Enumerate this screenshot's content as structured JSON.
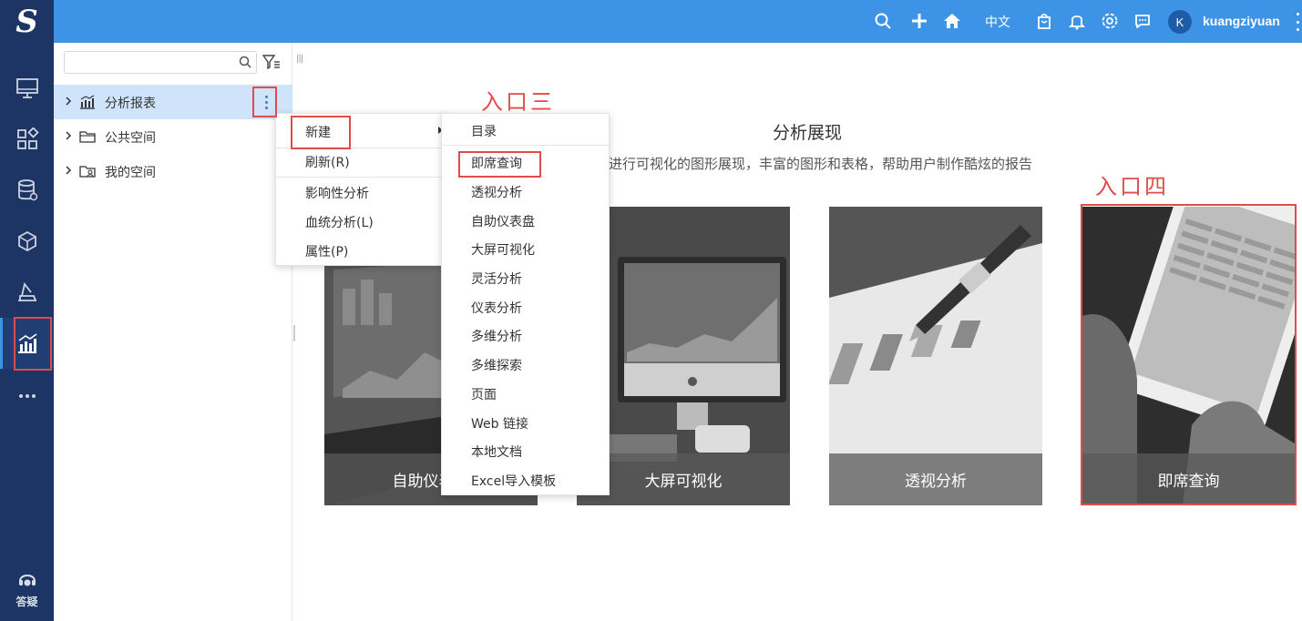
{
  "topbar": {
    "logo": "S",
    "language": "中文",
    "avatar_initial": "K",
    "username": "kuangziyuan",
    "icons": [
      "search-icon",
      "plus-icon",
      "home-icon",
      "bag-icon",
      "bell-icon",
      "settings-eye-icon",
      "chat-icon",
      "more-vertical-icon"
    ]
  },
  "leftnav": {
    "items": [
      "monitor-icon",
      "grid-icon",
      "database-icon",
      "cube-icon",
      "analysis-tool-icon",
      "chart-icon"
    ],
    "active": "chart-icon",
    "help_label": "答疑"
  },
  "tree": {
    "search_placeholder": "",
    "rows": [
      {
        "label": "分析报表",
        "icon": "report-chart-icon",
        "selected": true
      },
      {
        "label": "公共空间",
        "icon": "folder-icon",
        "selected": false
      },
      {
        "label": "我的空间",
        "icon": "user-folder-icon",
        "selected": false
      }
    ]
  },
  "menu1": {
    "items": [
      "新建",
      "刷新(R)",
      "影响性分析",
      "血统分析(L)",
      "属性(P)"
    ]
  },
  "menu2": {
    "items": [
      "目录",
      "即席查询",
      "透视分析",
      "自助仪表盘",
      "大屏可视化",
      "灵活分析",
      "仪表分析",
      "多维分析",
      "多维探索",
      "页面",
      "Web 链接",
      "本地文档",
      "Excel导入模板"
    ]
  },
  "main": {
    "title": "分析展现",
    "description": "进行可视化的图形展现，丰富的图形和表格，帮助用户制作酷炫的报告",
    "cards": [
      {
        "caption": "自助仪表盘"
      },
      {
        "caption": "大屏可视化"
      },
      {
        "caption": "透视分析"
      },
      {
        "caption": "即席查询"
      }
    ]
  },
  "annotations": {
    "entry3": "入口三",
    "entry4": "入口四",
    "color": "#e04b4b"
  },
  "colors": {
    "topbar": "#3d94e6",
    "nav": "#1c3565",
    "selected_row": "#cfe4fa"
  }
}
